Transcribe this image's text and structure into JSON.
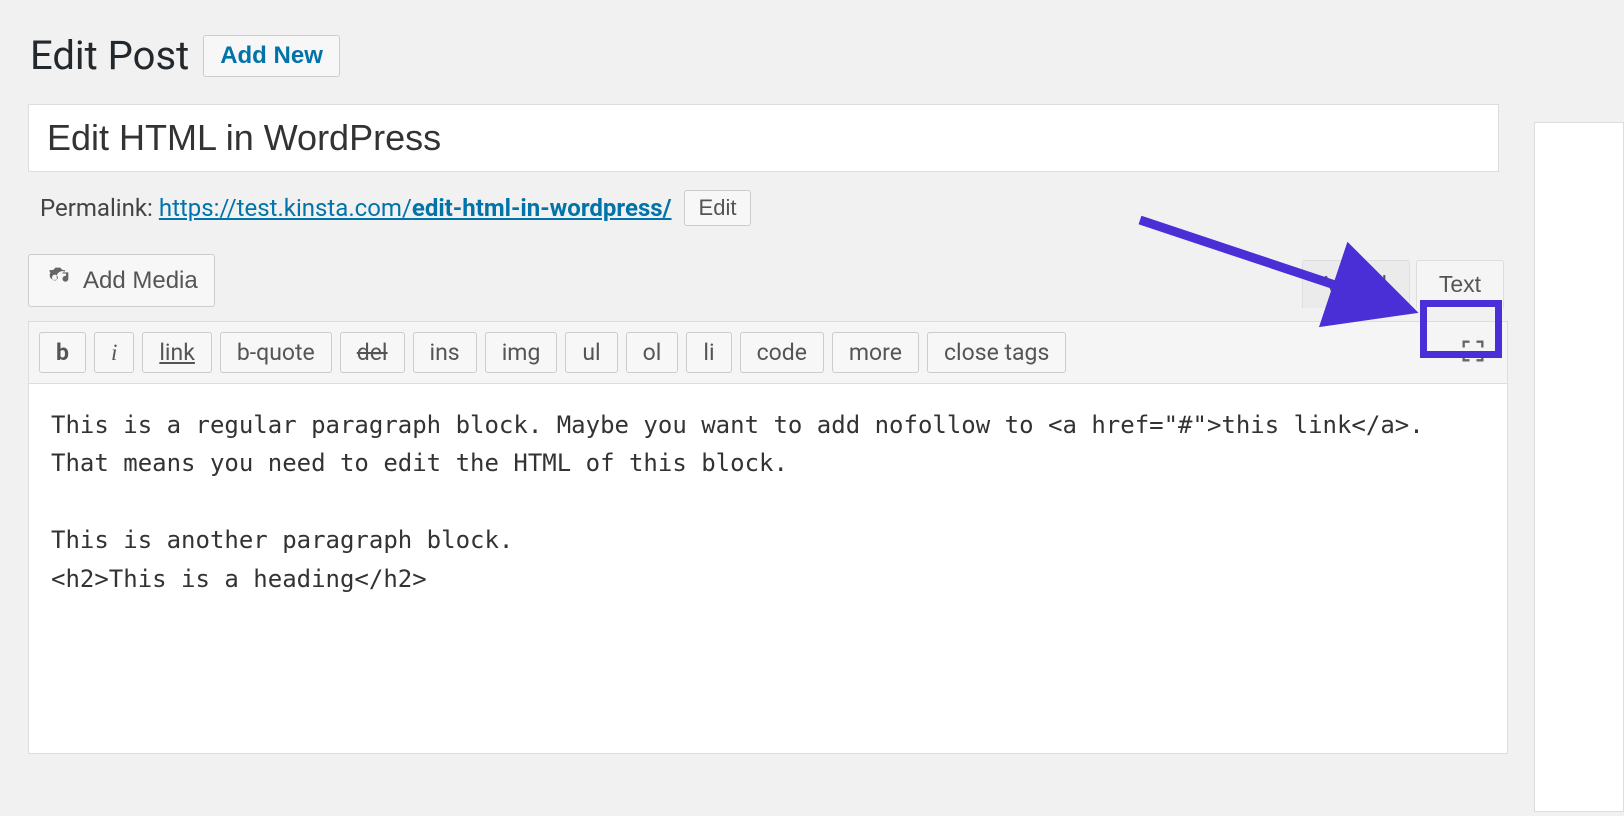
{
  "page": {
    "heading": "Edit Post",
    "add_new_label": "Add New"
  },
  "post": {
    "title": "Edit HTML in WordPress",
    "permalink_label": "Permalink:",
    "permalink_base": "https://test.kinsta.com/",
    "permalink_slug": "edit-html-in-wordpress/",
    "edit_slug_label": "Edit",
    "content": "This is a regular paragraph block. Maybe you want to add nofollow to <a href=\"#\">this link</a>. That means you need to edit the HTML of this block.\n\nThis is another paragraph block.\n<h2>This is a heading</h2>"
  },
  "editor": {
    "add_media_label": "Add Media",
    "tabs": {
      "visual": "Visual",
      "text": "Text"
    },
    "quicktags": {
      "b": "b",
      "i": "i",
      "link": "link",
      "bquote": "b-quote",
      "del": "del",
      "ins": "ins",
      "img": "img",
      "ul": "ul",
      "ol": "ol",
      "li": "li",
      "code": "code",
      "more": "more",
      "close": "close tags"
    }
  }
}
